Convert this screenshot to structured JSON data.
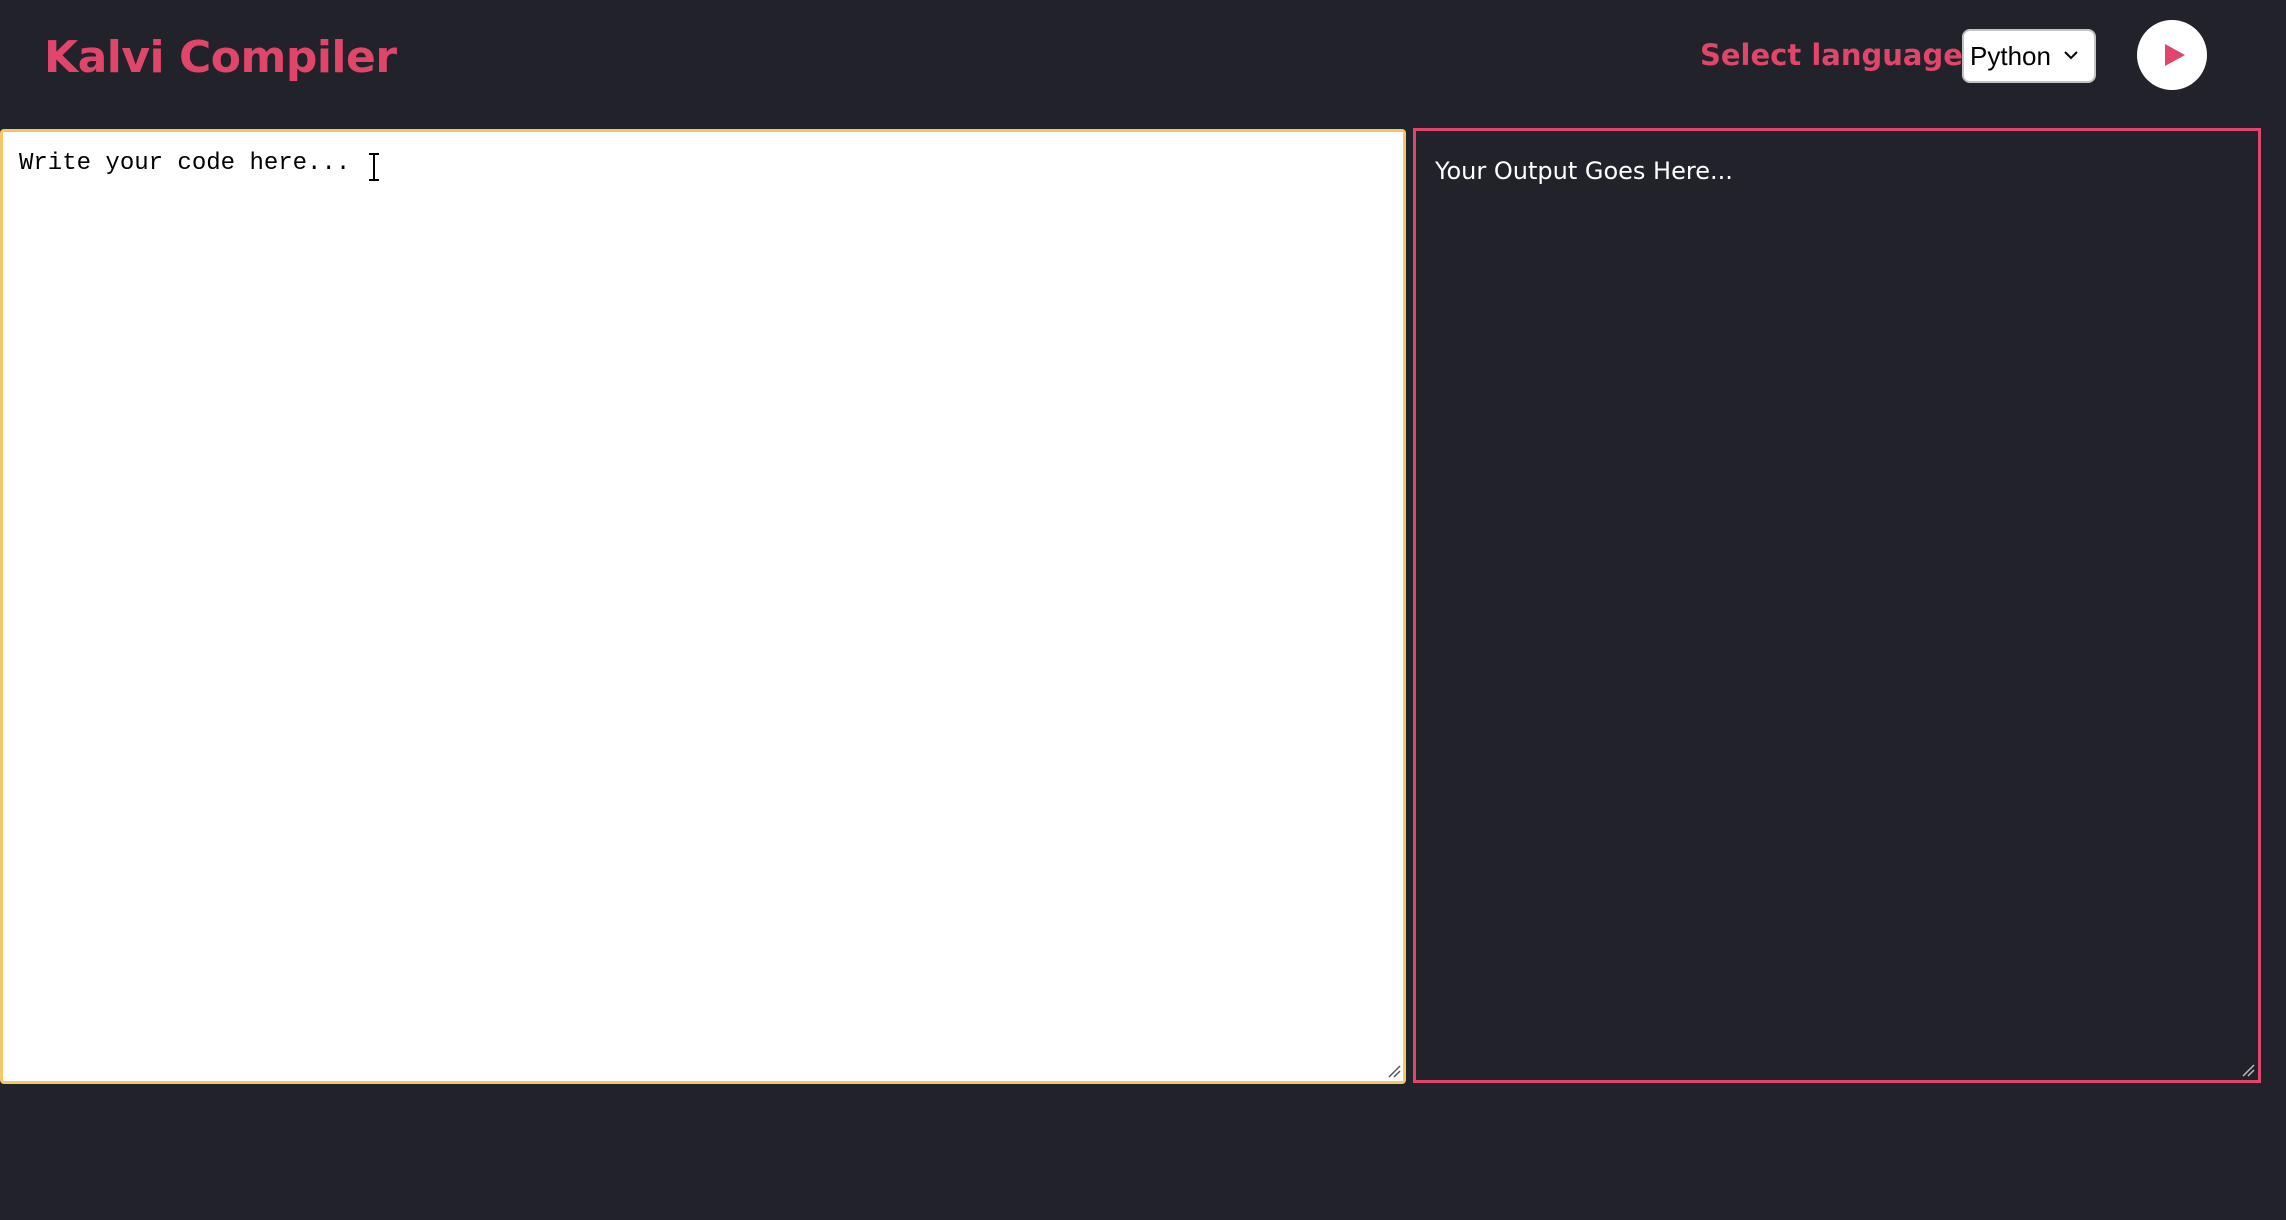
{
  "header": {
    "title": "Kalvi Compiler",
    "language_label": "Select language :",
    "language_selected": "Python",
    "run_button_icon": "play-icon"
  },
  "editor": {
    "placeholder": "Write your code here..."
  },
  "output": {
    "text": "Your Output Goes Here..."
  },
  "colors": {
    "background": "#22232a",
    "accent": "#e0466a",
    "editor_border": "#f3c768",
    "output_text": "#ffffff"
  }
}
